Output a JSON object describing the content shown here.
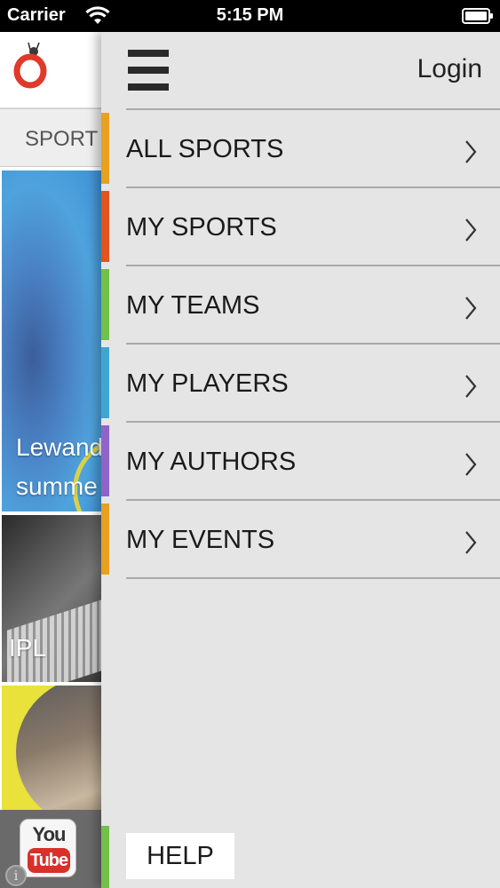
{
  "status_bar": {
    "carrier": "Carrier",
    "time": "5:15 PM",
    "wifi_icon": "wifi-icon",
    "battery_icon": "battery-icon"
  },
  "background_app": {
    "logo_icon": "app-logo-icon",
    "tab_label": "SPORT",
    "tiles": [
      {
        "caption_line1": "Lewand",
        "caption_line2": "summe"
      },
      {
        "caption_line1": "IPL"
      }
    ],
    "youtube": {
      "you": "You",
      "tube": "Tube"
    },
    "info_icon": "i"
  },
  "drawer": {
    "menu_icon": "hamburger-icon",
    "login_label": "Login",
    "items": [
      {
        "label": "ALL SPORTS",
        "accent": "#e7a11f"
      },
      {
        "label": "MY SPORTS",
        "accent": "#e2531d"
      },
      {
        "label": "MY TEAMS",
        "accent": "#72c04a"
      },
      {
        "label": "MY PLAYERS",
        "accent": "#3fa7cf"
      },
      {
        "label": "MY AUTHORS",
        "accent": "#8f64c8"
      },
      {
        "label": "MY EVENTS",
        "accent": "#e7a11f"
      }
    ],
    "help_label": "HELP",
    "help_accent": "#72c04a"
  }
}
